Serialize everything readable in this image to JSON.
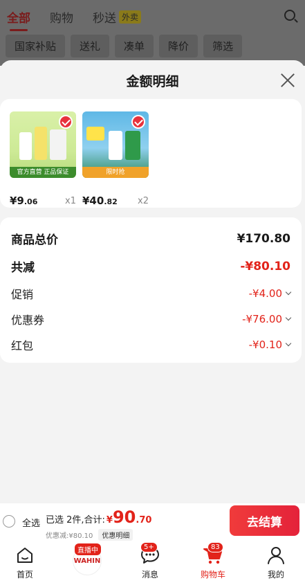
{
  "background": {
    "tabs": [
      "全部",
      "购物",
      "秒送"
    ],
    "tab_badge": "外卖",
    "filters": [
      "国家补贴",
      "送礼",
      "凑单",
      "降价",
      "筛选"
    ]
  },
  "sheet": {
    "title": "金额明细",
    "products": [
      {
        "price_int": "¥9",
        "price_dec": ".06",
        "qty": "x1",
        "thumb_caption": "官方直营 正品保证"
      },
      {
        "price_int": "¥40",
        "price_dec": ".82",
        "qty": "x2",
        "thumb_caption": "限时抢"
      }
    ],
    "summary": {
      "total_label": "商品总价",
      "total_value": "¥170.80",
      "reduce_label": "共减",
      "reduce_value": "-¥80.10",
      "promo_label": "促销",
      "promo_value": "-¥4.00",
      "coupon_label": "优惠券",
      "coupon_value": "-¥76.00",
      "redpack_label": "红包",
      "redpack_value": "-¥0.10"
    }
  },
  "checkout": {
    "select_all": "全选",
    "selected_prefix": "已选 2件,合计:",
    "currency": "¥",
    "total_int": "90",
    "total_dec": ".70",
    "discount_text": "优惠减:¥80.10",
    "detail_chip": "优惠明细",
    "button": "去结算"
  },
  "tabbar": {
    "home": "首页",
    "live_badge": "直播中",
    "live_logo": "WAHIN",
    "messages": "消息",
    "messages_badge": "5+",
    "cart": "购物车",
    "cart_badge": "83",
    "me": "我的"
  },
  "colors": {
    "accent": "#e2231a",
    "checkout_btn": "#e4223a"
  }
}
